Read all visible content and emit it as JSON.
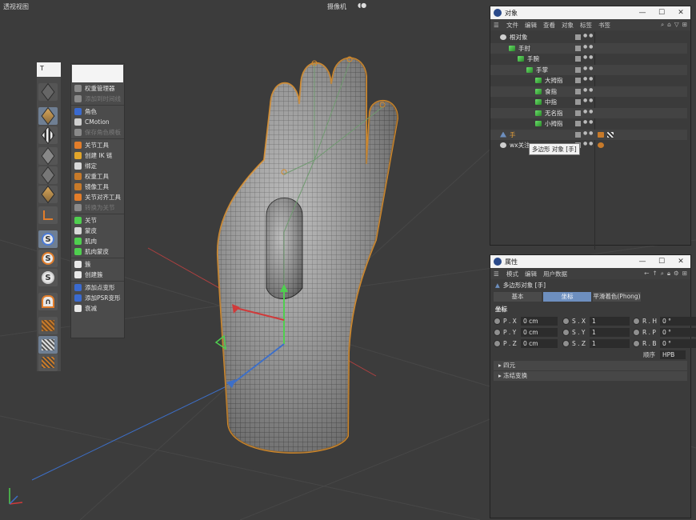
{
  "viewport": {
    "label": "透视视图",
    "camera": "摄像机"
  },
  "left_toolbar": {
    "top_field": "T"
  },
  "character_menu": {
    "items": [
      {
        "label": "权重管理器",
        "enabled": true
      },
      {
        "label": "添加到时间线",
        "enabled": false
      },
      {
        "label": "角色",
        "enabled": true
      },
      {
        "label": "CMotion",
        "enabled": true
      },
      {
        "label": "保存角色模板",
        "enabled": false
      },
      {
        "label": "关节工具",
        "enabled": true
      },
      {
        "label": "创建 IK 链",
        "enabled": true
      },
      {
        "label": "绑定",
        "enabled": true
      },
      {
        "label": "权重工具",
        "enabled": true
      },
      {
        "label": "镜像工具",
        "enabled": true
      },
      {
        "label": "关节对齐工具",
        "enabled": true
      },
      {
        "label": "转换为关节",
        "enabled": false
      },
      {
        "label": "关节",
        "enabled": true
      },
      {
        "label": "蒙皮",
        "enabled": true
      },
      {
        "label": "肌肉",
        "enabled": true
      },
      {
        "label": "肌肉蒙皮",
        "enabled": true
      },
      {
        "label": "簇",
        "enabled": true
      },
      {
        "label": "创建簇",
        "enabled": true
      },
      {
        "label": "添加点变形",
        "enabled": true
      },
      {
        "label": "添加PSR变形",
        "enabled": true
      },
      {
        "label": "衰减",
        "enabled": true
      }
    ]
  },
  "objects_panel": {
    "title": "对象",
    "menu": [
      "文件",
      "编辑",
      "查看",
      "对象",
      "标签",
      "书签"
    ],
    "tree": [
      {
        "name": "根对象",
        "depth": 0,
        "kind": "null"
      },
      {
        "name": "手肘",
        "depth": 1,
        "kind": "joint"
      },
      {
        "name": "手腕",
        "depth": 2,
        "kind": "joint"
      },
      {
        "name": "手掌",
        "depth": 3,
        "kind": "joint"
      },
      {
        "name": "大拇指",
        "depth": 4,
        "kind": "joint"
      },
      {
        "name": "食指",
        "depth": 4,
        "kind": "joint"
      },
      {
        "name": "中指",
        "depth": 4,
        "kind": "joint"
      },
      {
        "name": "无名指",
        "depth": 4,
        "kind": "joint"
      },
      {
        "name": "小拇指",
        "depth": 4,
        "kind": "joint"
      },
      {
        "name": "手",
        "depth": 0,
        "kind": "mesh"
      },
      {
        "name": "wx关注",
        "depth": 0,
        "kind": "null"
      }
    ],
    "tooltip": "多边形 对象 [手]"
  },
  "attributes_panel": {
    "title": "属性",
    "menu": [
      "模式",
      "编辑",
      "用户数据"
    ],
    "object_label": "多边形对象 [手]",
    "tabs": [
      {
        "label": "基本",
        "active": false
      },
      {
        "label": "坐标",
        "active": true
      },
      {
        "label": "平滑着色(Phong)",
        "active": false
      }
    ],
    "section": "坐标",
    "coords": [
      {
        "p_label": "P . X",
        "p_value": "0 cm",
        "s_label": "S . X",
        "s_value": "1",
        "r_label": "R . H",
        "r_value": "0 °"
      },
      {
        "p_label": "P . Y",
        "p_value": "0 cm",
        "s_label": "S . Y",
        "s_value": "1",
        "r_label": "R . P",
        "r_value": "0 °"
      },
      {
        "p_label": "P . Z",
        "p_value": "0 cm",
        "s_label": "S . Z",
        "s_value": "1",
        "r_label": "R . B",
        "r_value": "0 °"
      }
    ],
    "order_label": "顺序",
    "order_value": "HPB",
    "folds": [
      "四元",
      "冻结变换"
    ]
  },
  "colors": {
    "accent_blue": "#6d8fbf",
    "mesh_outline": "#d48a2a",
    "joint_green": "#4fcf4f"
  }
}
